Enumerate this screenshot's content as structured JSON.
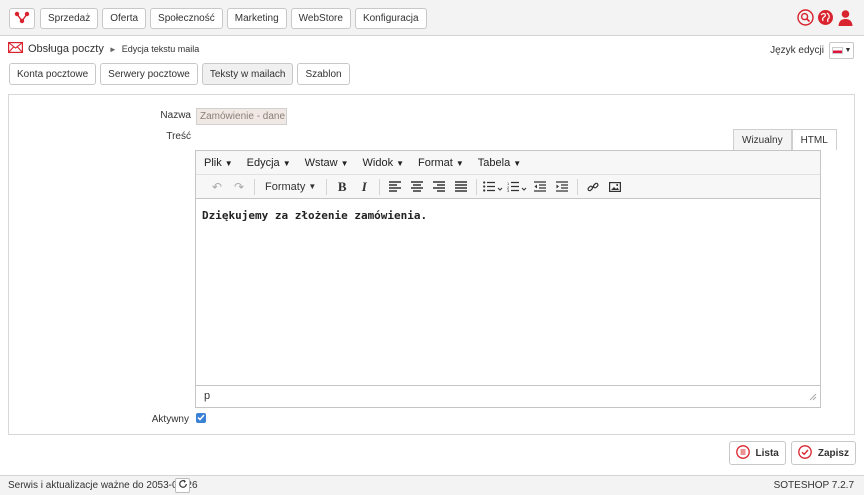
{
  "colors": {
    "accent": "#d9232e",
    "checkbox": "#3b82d6"
  },
  "nav": {
    "logo_icon": "network-logo-icon",
    "items": [
      "Sprzedaż",
      "Oferta",
      "Społeczność",
      "Marketing",
      "WebStore",
      "Konfiguracja"
    ],
    "icons": [
      "search-icon",
      "globe-icon",
      "user-icon"
    ]
  },
  "breadcrumb": {
    "icon": "envelope-icon",
    "main": "Obsługa poczty",
    "separator": "►",
    "current": "Edycja tekstu maila"
  },
  "language": {
    "label": "Język edycji"
  },
  "subtabs": [
    "Konta pocztowe",
    "Serwery pocztowe",
    "Teksty w mailach",
    "Szablon"
  ],
  "form": {
    "name_label": "Nazwa",
    "name_value": "Zamówienie - dane zam",
    "content_label": "Treść",
    "active_label": "Aktywny",
    "active_checked": true
  },
  "editor": {
    "modes": [
      "Wizualny",
      "HTML"
    ],
    "menus": [
      "Plik",
      "Edycja",
      "Wstaw",
      "Widok",
      "Format",
      "Tabela"
    ],
    "formats_label": "Formaty",
    "content": "Dziękujemy za złożenie zamówienia.",
    "path": "p"
  },
  "actions": {
    "list_label": "Lista",
    "save_label": "Zapisz"
  },
  "footer": {
    "service_text": "Serwis i aktualizacje ważne do 2053-08-26",
    "version": "SOTESHOP 7.2.7"
  }
}
